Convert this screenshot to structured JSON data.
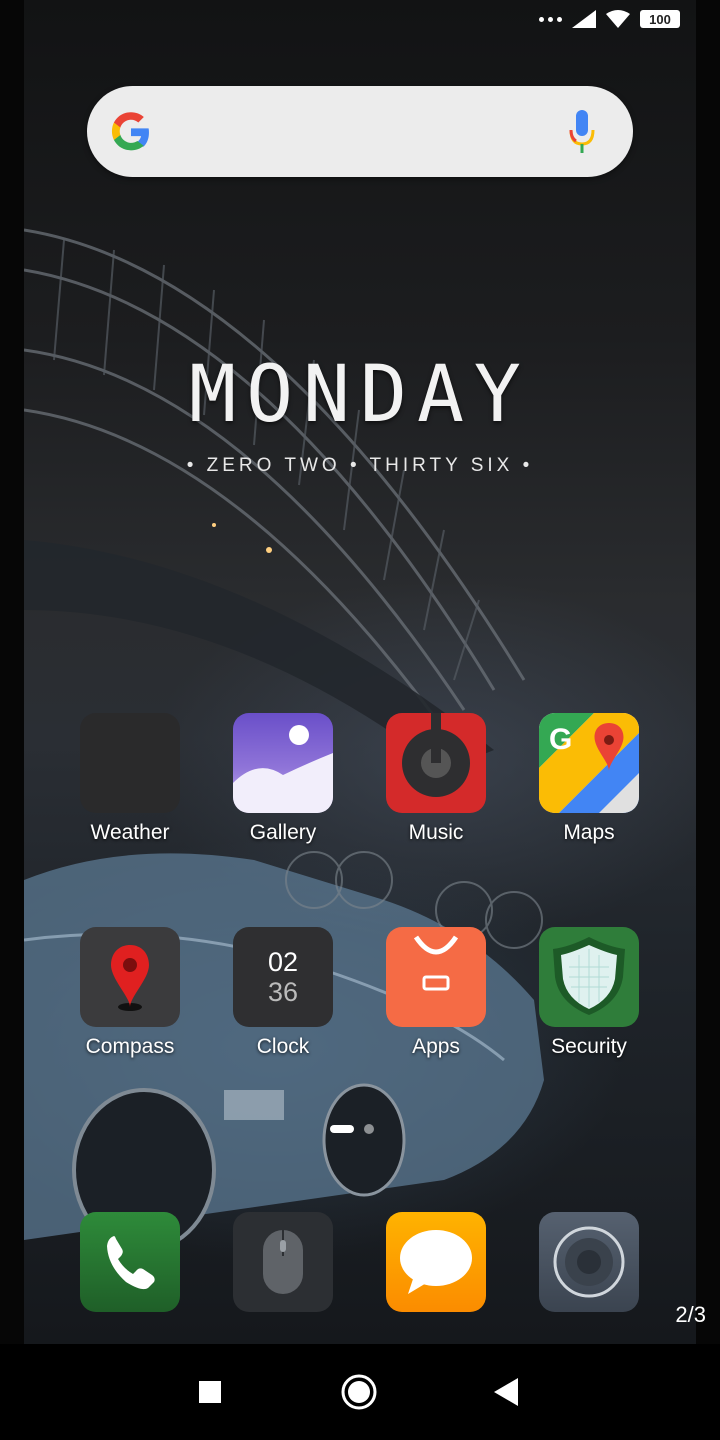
{
  "status_bar": {
    "battery": "100",
    "icons": [
      "more-dots-icon",
      "signal-icon",
      "wifi-icon",
      "battery-icon"
    ]
  },
  "search_bar": {
    "icons": [
      "google-logo-icon",
      "microphone-icon"
    ]
  },
  "clock_widget": {
    "day": "MONDAY",
    "time_words": "• ZERO TWO • THIRTY SIX •"
  },
  "apps_row1": [
    {
      "label": "Weather",
      "icon": "weather-icon"
    },
    {
      "label": "Gallery",
      "icon": "gallery-icon"
    },
    {
      "label": "Music",
      "icon": "music-icon"
    },
    {
      "label": "Maps",
      "icon": "maps-icon"
    }
  ],
  "apps_row2": [
    {
      "label": "Compass",
      "icon": "compass-icon"
    },
    {
      "label": "Clock",
      "icon": "clock-icon",
      "hour": "02",
      "minute": "36"
    },
    {
      "label": "Apps",
      "icon": "mi-apps-icon"
    },
    {
      "label": "Security",
      "icon": "security-shield-icon"
    }
  ],
  "dock": [
    {
      "icon": "phone-icon"
    },
    {
      "icon": "mouse-icon"
    },
    {
      "icon": "messages-icon"
    },
    {
      "icon": "camera-icon"
    }
  ],
  "page": {
    "current": 1,
    "total_dots": 2,
    "indicator": "2/3"
  },
  "colors": {
    "maps_green": "#34a853",
    "music_red": "#d42a2a",
    "apps_orange": "#f56b45",
    "security_green": "#2f7d3a",
    "phone_green": "#2e7d32",
    "messages_orange": "#ff9800",
    "gallery_purple": "#7e57c2"
  },
  "navbar": {
    "icons": [
      "recents-square-icon",
      "home-circle-icon",
      "back-triangle-icon"
    ]
  }
}
